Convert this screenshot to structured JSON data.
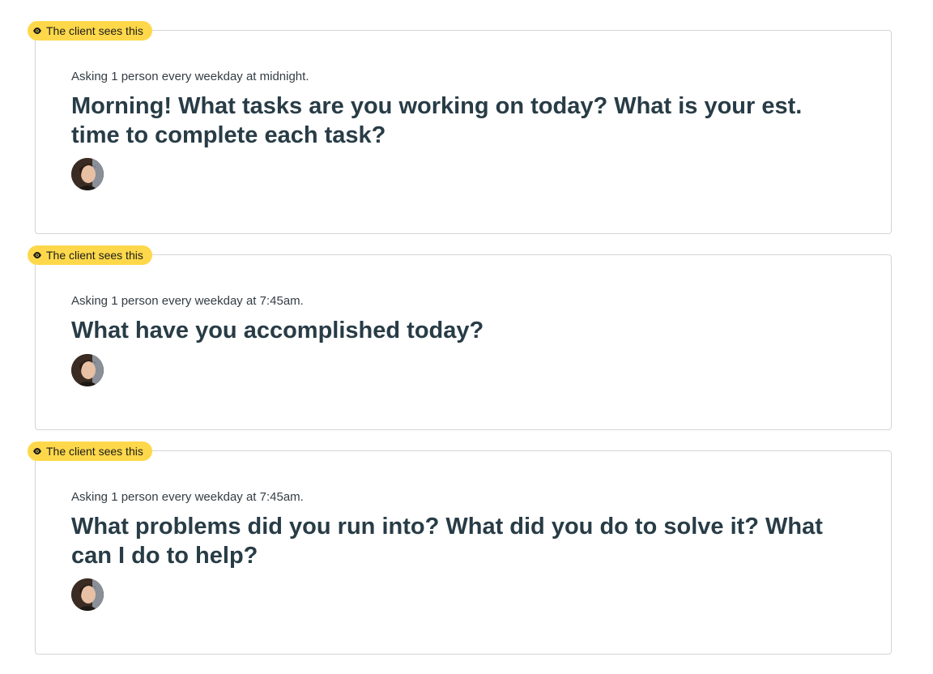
{
  "checkins": [
    {
      "badge_label": "The client sees this",
      "schedule": "Asking 1 person every weekday at midnight.",
      "question": "Morning! What tasks are you working on today? What is your est. time to complete each task?",
      "avatar_icon": "user-avatar-photo"
    },
    {
      "badge_label": "The client sees this",
      "schedule": "Asking 1 person every weekday at 7:45am.",
      "question": "What have you accomplished today?",
      "avatar_icon": "user-avatar-photo"
    },
    {
      "badge_label": "The client sees this",
      "schedule": "Asking 1 person every weekday at 7:45am.",
      "question": "What problems did you run into? What did you do to solve it? What can I do to help?",
      "avatar_icon": "user-avatar-photo"
    }
  ],
  "colors": {
    "badge_bg": "#fed84a",
    "text": "#283c46",
    "border": "#d5d5d5"
  }
}
